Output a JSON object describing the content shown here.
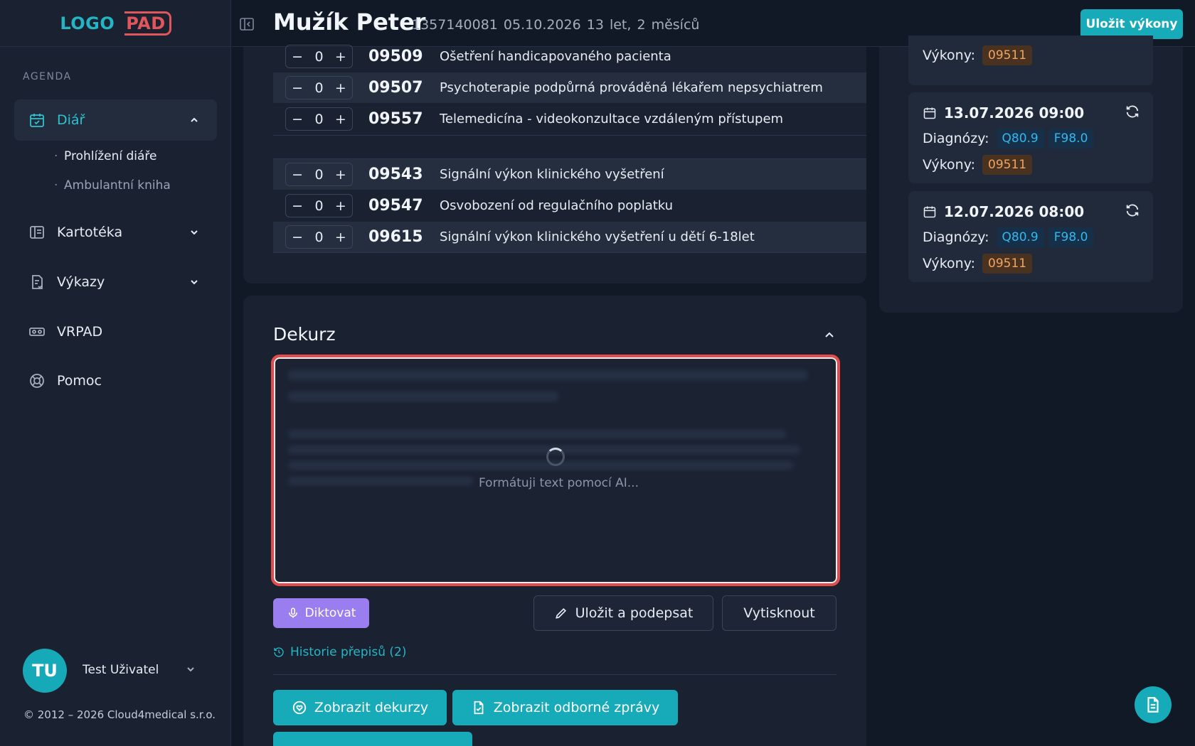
{
  "sidebar": {
    "logo_left": "LOGO",
    "logo_right": "PAD",
    "section_label": "AGENDA",
    "nav": [
      {
        "label": "Diář",
        "icon": "calendar-check-icon"
      },
      {
        "label": "Kartotéka",
        "icon": "card-index-icon"
      },
      {
        "label": "Výkazy",
        "icon": "report-icon"
      },
      {
        "label": "VRPAD",
        "icon": "vr-headset-icon"
      },
      {
        "label": "Pomoc",
        "icon": "lifebuoy-icon"
      }
    ],
    "sub_items": [
      "Prohlížení diáře",
      "Ambulantní kniha"
    ],
    "user": {
      "initials": "TU",
      "name": "Test Uživatel"
    },
    "copyright": "© 2012 – 2026 Cloud4medical s.r.o."
  },
  "header": {
    "patient_name": "Mužík Peter",
    "patient_meta": "1357140081  05.10.2026  13 let, 2 měsíců",
    "save_button": "Uložit výkony"
  },
  "codes": {
    "group_a": [
      {
        "qty": "0",
        "code": "09509",
        "desc": "Ošetření handicapovaného pacienta"
      },
      {
        "qty": "0",
        "code": "09507",
        "desc": "Psychoterapie podpůrná prováděná lékařem nepsychiatrem"
      },
      {
        "qty": "0",
        "code": "09557",
        "desc": "Telemedicína - videokonzultace vzdáleným přístupem"
      }
    ],
    "group_b": [
      {
        "qty": "0",
        "code": "09543",
        "desc": "Signální výkon klinického vyšetření"
      },
      {
        "qty": "0",
        "code": "09547",
        "desc": "Osvobození od regulačního poplatku"
      },
      {
        "qty": "0",
        "code": "09615",
        "desc": "Signální výkon klinického vyšetření u dětí 6-18let"
      }
    ],
    "minus": "−",
    "plus": "+"
  },
  "dekurz": {
    "title": "Dekurz",
    "loading_text": "Formátuji text pomocí AI...",
    "dictate_button": "Diktovat",
    "sign_button": "Uložit a podepsat",
    "print_button": "Vytisknout",
    "history_link": "Historie přepisů (2)",
    "show_dekurzy_button": "Zobrazit dekurzy",
    "show_reports_button": "Zobrazit odborné zprávy"
  },
  "visits": {
    "diag_label": "Diagnózy:",
    "vyk_label": "Výkony:",
    "items": [
      {
        "date": "",
        "diagnoses": [],
        "vykony": [
          "09511"
        ]
      },
      {
        "date": "13.07.2026 09:00",
        "diagnoses": [
          "Q80.9",
          "F98.0"
        ],
        "vykony": [
          "09511"
        ]
      },
      {
        "date": "12.07.2026 08:00",
        "diagnoses": [
          "Q80.9",
          "F98.0"
        ],
        "vykony": [
          "09511"
        ]
      }
    ]
  },
  "colors": {
    "accent": "#17aab8",
    "danger_outline": "#e34c4c",
    "dictate": "#9a7ef0",
    "diagnosis_tag": "#33b8ee",
    "vykon_tag": "#f0a460"
  }
}
